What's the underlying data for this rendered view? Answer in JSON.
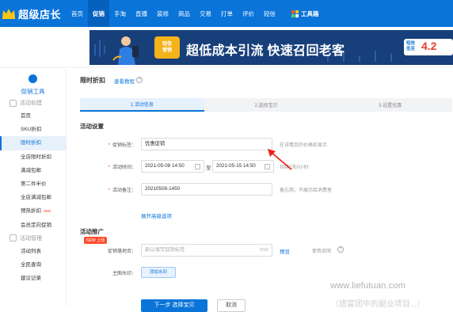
{
  "app": {
    "name": "超级店长",
    "brand_color": "#0a74d9"
  },
  "nav": {
    "items": [
      "首页",
      "促销",
      "手淘",
      "直播",
      "装修",
      "商品",
      "交易",
      "打单",
      "评价",
      "短信"
    ],
    "active": "促销",
    "toolbox": "工具箱"
  },
  "banner": {
    "tag_line1": "短信",
    "tag_line2": "营销",
    "headline": "超低成本引流 快速召回老客",
    "promo_label_1": "短信",
    "promo_label_2": "低至",
    "promo_value": "4.2"
  },
  "sidebar": {
    "title": "促销工具",
    "group1": "活动创建",
    "items1": [
      {
        "label": "首页"
      },
      {
        "label": "SKU折扣"
      },
      {
        "label": "限时折扣",
        "active": true
      },
      {
        "label": "全店限时折扣"
      },
      {
        "label": "满减包邮"
      },
      {
        "label": "第二件半价"
      },
      {
        "label": "全店满减包邮"
      },
      {
        "label": "预热折扣",
        "badge": "new"
      },
      {
        "label": "会员定向促销"
      }
    ],
    "group2": "活动管理",
    "items2": [
      {
        "label": "活动列表"
      },
      {
        "label": "全民查询"
      },
      {
        "label": "建议记录"
      }
    ]
  },
  "page": {
    "title": "限时折扣",
    "tutorial_link": "查看教程",
    "help_mark": "?"
  },
  "steps": [
    "1.活动信息",
    "2.选择宝贝",
    "3.设置优惠"
  ],
  "settings": {
    "section_title": "活动设置",
    "tag_label": "促销标签：",
    "tag_value": "优惠促销",
    "tag_hint": "在详情页的价格前显示",
    "time_label": "活动时间：",
    "start_time": "2021-05-08 14:50",
    "time_separator": "至",
    "end_time": "2021-05-15 14:50",
    "duration_hint": "持续7天0小时",
    "note_label": "活动备注：",
    "note_value": "20210508-1450",
    "note_hint": "备忘用，不展示给消费者",
    "advanced_link": "展开高级选项"
  },
  "promotion": {
    "section_title": "活动推广",
    "new_badge": "NEW 上线",
    "landing_label": "促销落地页：",
    "landing_placeholder": "新认填写促销标签",
    "landing_count": "0/10",
    "preview_link": "预览",
    "usage_hint": "使用说明",
    "watermark_label": "主图水印：",
    "watermark_button": "添加水印"
  },
  "actions": {
    "primary": "下一步 选择宝贝",
    "secondary": "取消"
  },
  "site_watermark": {
    "line1": "www.liefutuan.com",
    "line2": "（猎富团中的副业项目...）"
  }
}
